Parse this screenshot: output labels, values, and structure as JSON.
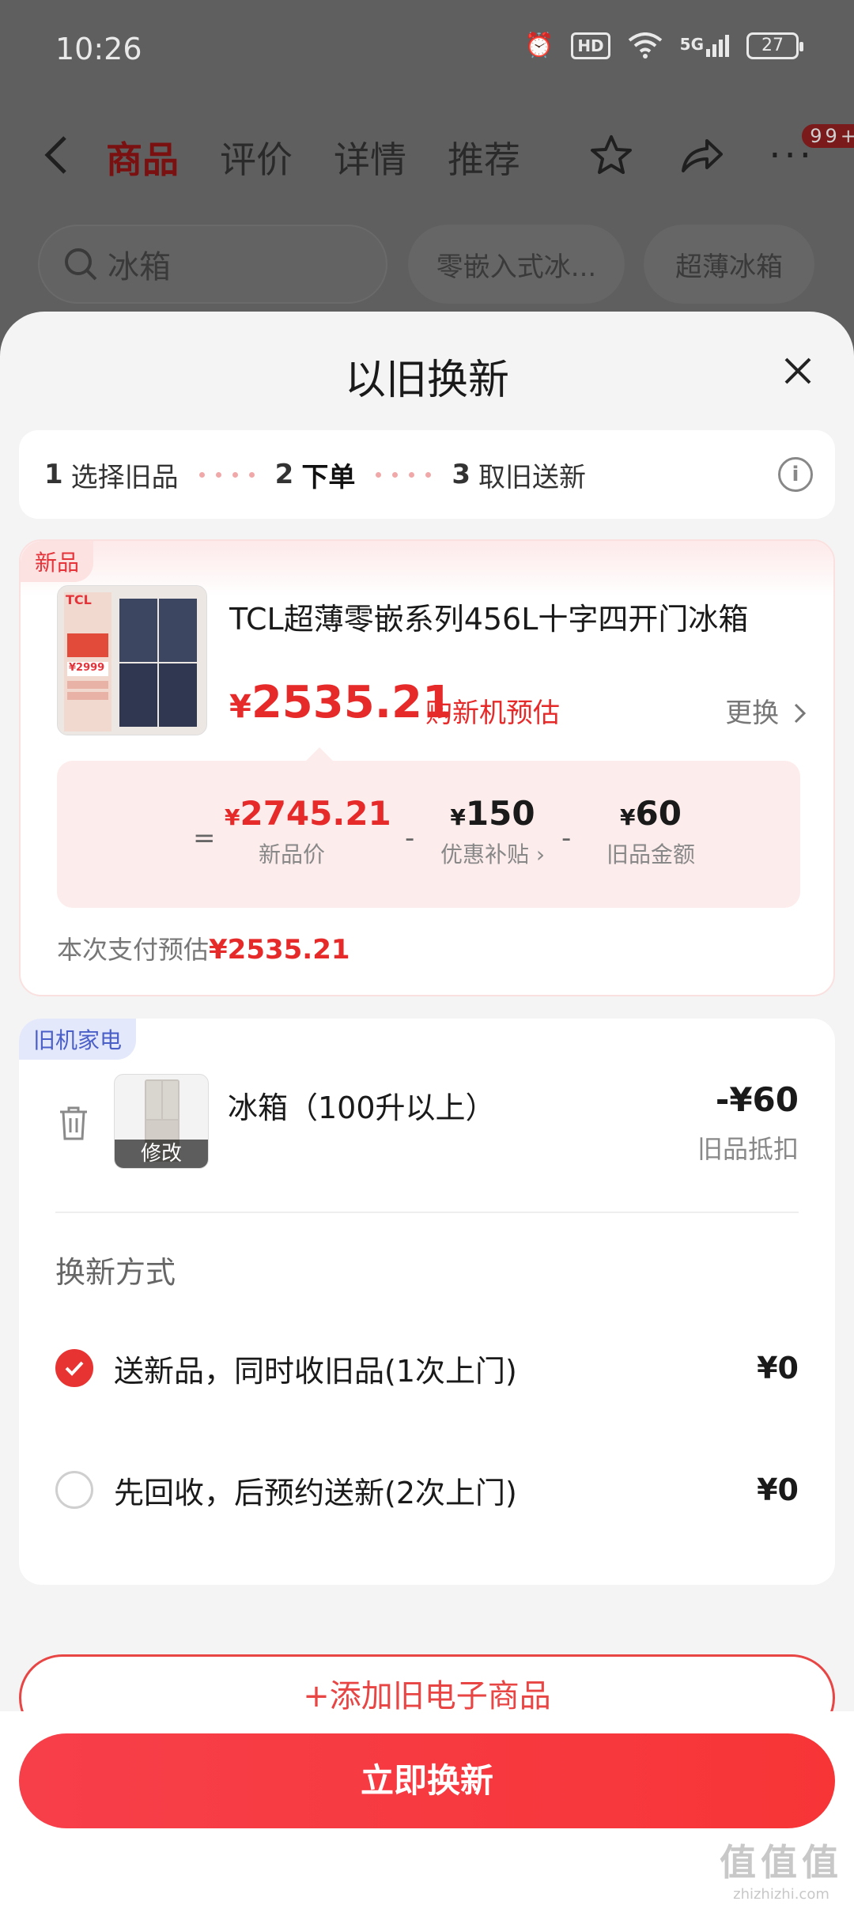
{
  "status_bar": {
    "time": "10:26",
    "hd": "HD",
    "network": "5G",
    "battery": "27"
  },
  "nav": {
    "tabs": [
      "商品",
      "评价",
      "详情",
      "推荐"
    ],
    "badge": "99+"
  },
  "search": {
    "placeholder": "冰箱",
    "chips": [
      "零嵌入式冰...",
      "超薄冰箱"
    ]
  },
  "sheet": {
    "title": "以旧换新",
    "steps": [
      {
        "num": "1",
        "label": "选择旧品"
      },
      {
        "num": "2",
        "label": "下单"
      },
      {
        "num": "3",
        "label": "取旧送新"
      }
    ],
    "info_icon_text": "i"
  },
  "new_product": {
    "tag": "新品",
    "title": "TCL超薄零嵌系列456L十字四开门冰箱",
    "price_currency": "¥",
    "price": "2535.21",
    "price_label": "购新机预估",
    "change_label": "更换",
    "image_brand": "TCL",
    "image_price": "¥2999",
    "calc": {
      "eq": "=",
      "minus": "-",
      "new_price": "2745.21",
      "new_price_label": "新品价",
      "subsidy": "150",
      "subsidy_label": "优惠补贴",
      "old_amount": "60",
      "old_amount_label": "旧品金额"
    },
    "pay_estimate_label": "本次支付预估",
    "pay_estimate_value": "¥2535.21"
  },
  "old_product": {
    "tag": "旧机家电",
    "name": "冰箱（100升以上）",
    "modify": "修改",
    "amount": "-¥60",
    "amount_label": "旧品抵扣",
    "method_title": "换新方式",
    "options": [
      {
        "label": "送新品，同时收旧品(1次上门)",
        "price": "¥0",
        "checked": true
      },
      {
        "label": "先回收，后预约送新(2次上门)",
        "price": "¥0",
        "checked": false
      }
    ]
  },
  "add_button": "+添加旧电子商品",
  "submit_button": "立即换新",
  "watermark": {
    "logo": "值值值",
    "site": "zhizhizhi.com"
  },
  "colors": {
    "accent": "#E62A2A",
    "old_tag": "#4B5FC8"
  }
}
